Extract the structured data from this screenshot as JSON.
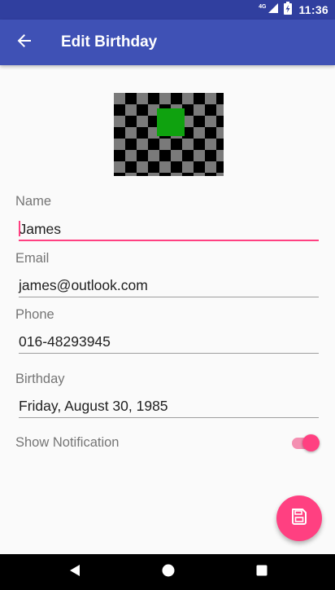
{
  "status_bar": {
    "network": "4G",
    "time": "11:36",
    "background": "#303f9f"
  },
  "app_bar": {
    "title": "Edit Birthday",
    "background": "#3f51b5",
    "back_icon": "arrow-back-icon"
  },
  "photo": {
    "description_icon": "checkerboard-image"
  },
  "form": {
    "name": {
      "label": "Name",
      "value": "James",
      "focused": true
    },
    "email": {
      "label": "Email",
      "value": "james@outlook.com"
    },
    "phone": {
      "label": "Phone",
      "value": "016-48293945"
    },
    "birthday": {
      "label": "Birthday",
      "value": "Friday, August 30, 1985"
    },
    "notification": {
      "label": "Show Notification",
      "enabled": true
    }
  },
  "fab": {
    "icon": "save-icon",
    "color": "#ff4081"
  },
  "nav_bar": {
    "back_icon": "nav-back-icon",
    "home_icon": "nav-home-icon",
    "recents_icon": "nav-recents-icon"
  },
  "colors": {
    "primary": "#3f51b5",
    "primary_dark": "#303f9f",
    "accent": "#ff4081"
  }
}
